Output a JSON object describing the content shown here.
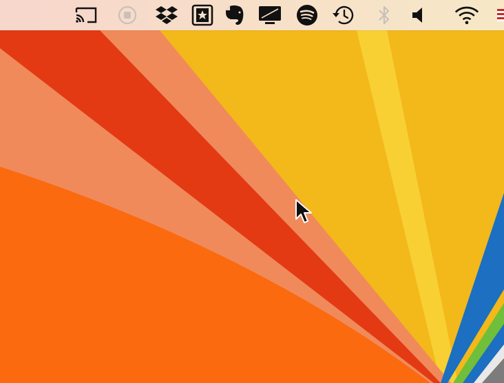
{
  "menubar": {
    "items": [
      {
        "name": "cast-icon"
      },
      {
        "name": "record-icon"
      },
      {
        "name": "dropbox-icon"
      },
      {
        "name": "bookmark-star-icon"
      },
      {
        "name": "evernote-icon"
      },
      {
        "name": "display-icon"
      },
      {
        "name": "spotify-icon"
      },
      {
        "name": "time-machine-icon"
      },
      {
        "name": "bluetooth-icon"
      },
      {
        "name": "volume-icon"
      },
      {
        "name": "wifi-icon"
      },
      {
        "name": "us-flag-icon"
      }
    ]
  },
  "wallpaper": {
    "colors": {
      "yellow": "#f3b81a",
      "pale_yellow": "#f8d33a",
      "salmon": "#f08a5a",
      "red": "#e33a14",
      "orange": "#fb6a0f",
      "blue": "#1c6fc1",
      "green": "#6fbf3a",
      "gray": "#7c7c7c"
    }
  }
}
